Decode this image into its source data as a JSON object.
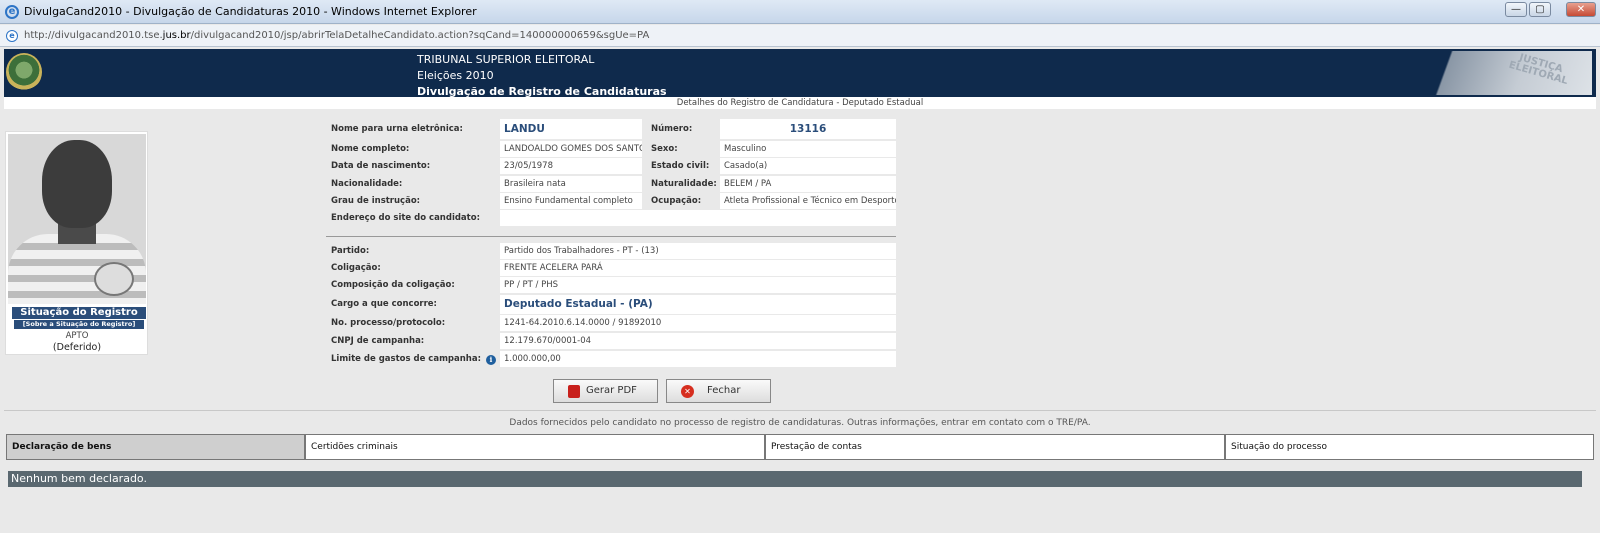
{
  "window": {
    "title": "DivulgaCand2010 - Divulgação de Candidaturas 2010 - Windows Internet Explorer",
    "min_icon": "minimize-icon",
    "max_icon": "maximize-icon",
    "close_icon": "close-icon"
  },
  "address": {
    "url_prefix": "http://divulgacand2010.tse.",
    "url_domain": "jus.br",
    "url_suffix": "/divulgacand2010/jsp/abrirTelaDetalheCandidato.action?sqCand=140000000659&sgUe=PA"
  },
  "header": {
    "line1": "TRIBUNAL SUPERIOR ELEITORAL",
    "line2": "Eleições 2010",
    "line3": "Divulgação de Registro de Candidaturas",
    "brand_art": "JUSTIÇA ELEITORAL"
  },
  "subtitle": "Detalhes do Registro de Candidatura - Deputado Estadual",
  "situacao": {
    "title": "Situação do Registro",
    "link": "[Sobre a Situação do Registro]",
    "status": "APTO",
    "detail": "(Deferido)"
  },
  "candidate": {
    "nome_urna_label": "Nome para urna eletrônica:",
    "nome_urna": "LANDU",
    "numero_label": "Número:",
    "numero": "13116",
    "nome_completo_label": "Nome completo:",
    "nome_completo": "LANDOALDO GOMES DOS SANTOS",
    "sexo_label": "Sexo:",
    "sexo": "Masculino",
    "nascimento_label": "Data de nascimento:",
    "nascimento": "23/05/1978",
    "estado_civil_label": "Estado civil:",
    "estado_civil": "Casado(a)",
    "nacionalidade_label": "Nacionalidade:",
    "nacionalidade": "Brasileira nata",
    "naturalidade_label": "Naturalidade:",
    "naturalidade": "BELEM / PA",
    "instrucao_label": "Grau de instrução:",
    "instrucao": "Ensino Fundamental completo",
    "ocupacao_label": "Ocupação:",
    "ocupacao": "Atleta Profissional e Técnico em Desportos",
    "site_label": "Endereço do site do candidato:",
    "site": "",
    "partido_label": "Partido:",
    "partido": "Partido dos Trabalhadores - PT - (13)",
    "coligacao_label": "Coligação:",
    "coligacao": "FRENTE ACELERA PARÁ",
    "composicao_label": "Composição da coligação:",
    "composicao": "PP / PT / PHS",
    "cargo_label": "Cargo a que concorre:",
    "cargo": "Deputado Estadual - (PA)",
    "processo_label": "No. processo/protocolo:",
    "processo": "1241-64.2010.6.14.0000 / 91892010",
    "cnpj_label": "CNPJ de campanha:",
    "cnpj": "12.179.670/0001-04",
    "limite_label": "Limite de gastos de campanha:",
    "limite": "1.000.000,00"
  },
  "buttons": {
    "pdf": "Gerar PDF",
    "fechar": "Fechar"
  },
  "note": "Dados fornecidos pelo candidato no processo de registro de candidaturas. Outras informações, entrar em contato com o TRE/PA.",
  "tabs": [
    {
      "label": "Declaração de bens"
    },
    {
      "label": "Certidões criminais"
    },
    {
      "label": "Prestação de contas"
    },
    {
      "label": "Situação do processo"
    }
  ],
  "bens_message": "Nenhum bem declarado."
}
